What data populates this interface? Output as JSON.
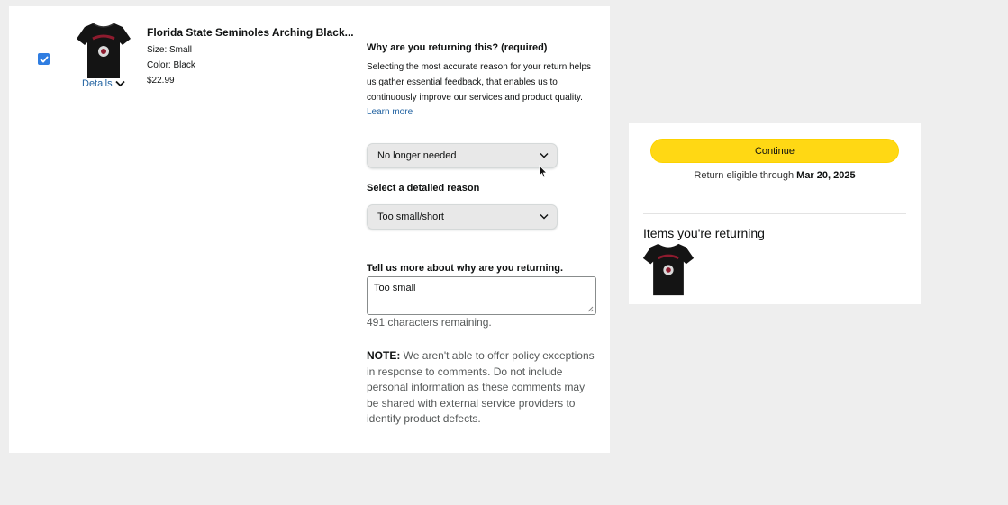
{
  "product": {
    "title": "Florida State Seminoles Arching Black...",
    "size": "Size: Small",
    "color": "Color: Black",
    "price": "$22.99",
    "details_label": "Details",
    "selected": true
  },
  "reason": {
    "heading": "Why are you returning this? (required)",
    "description": "Selecting the most accurate reason for your return helps us gather essential feedback, that enables us to continuously improve our services and product quality.",
    "learn_more": "Learn more",
    "selected_reason": "No longer needed",
    "detailed_heading": "Select a detailed reason",
    "detailed_selected": "Too small/short",
    "comment_heading": "Tell us more about why are you returning.",
    "comment_value": "Too small",
    "chars_remaining": "491 characters remaining.",
    "note_label": "NOTE:",
    "note_text": " We aren't able to offer policy exceptions in response to comments. Do not include personal information as these comments may be shared with external service providers to identify product defects."
  },
  "summary": {
    "continue_label": "Continue",
    "eligible_prefix": "Return eligible through ",
    "eligible_date": "Mar 20, 2025",
    "items_heading": "Items you're returning"
  },
  "colors": {
    "accent_button": "#ffd814",
    "link": "#2162a1",
    "checkbox": "#2f7de1"
  },
  "icons": [
    "checkmark-icon",
    "chevron-down-icon",
    "cursor-icon"
  ]
}
